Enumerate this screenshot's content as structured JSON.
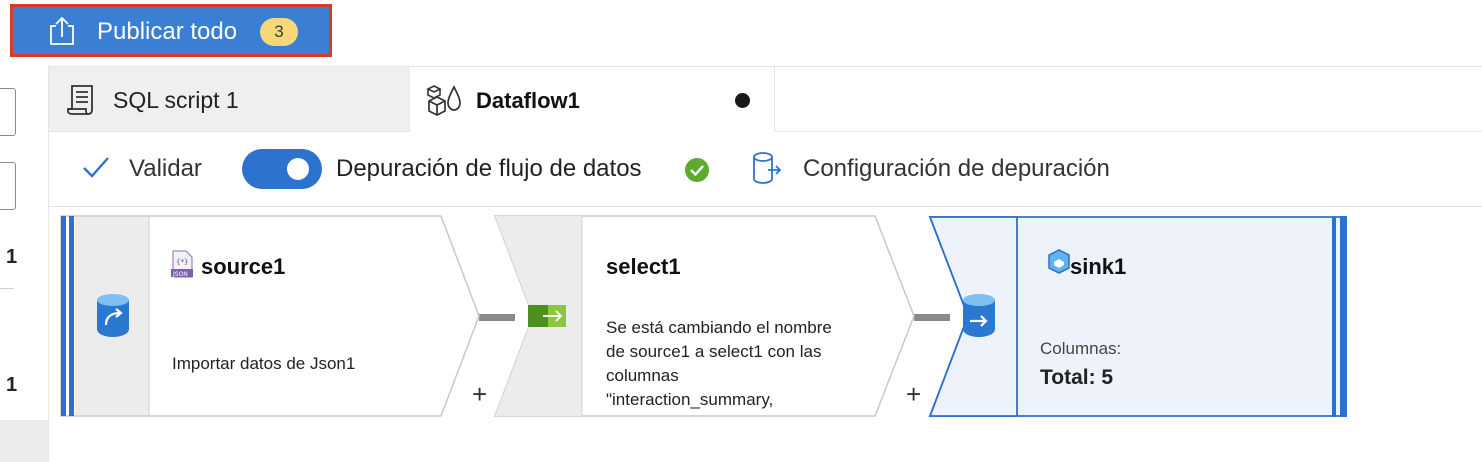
{
  "toolbar_top": {
    "publish_label": "Publicar todo",
    "publish_badge": "3"
  },
  "left_rail": {
    "numbers": [
      "1",
      "1"
    ]
  },
  "tabs": [
    {
      "label": "SQL script 1",
      "icon": "script-icon",
      "active": false
    },
    {
      "label": "Dataflow1",
      "icon": "dataflow-icon",
      "active": true,
      "unsaved": true
    }
  ],
  "dataflow_toolbar": {
    "validate_label": "Validar",
    "debug_label": "Depuración de flujo de datos",
    "debug_enabled": true,
    "debug_status": "ok",
    "config_label": "Configuración de depuración"
  },
  "nodes": {
    "source": {
      "title": "source1",
      "icon": "json-file-icon",
      "description": "Importar datos de Json1"
    },
    "select": {
      "title": "select1",
      "description_lines": [
        "Se está cambiando el nombre",
        "de source1 a select1 con las",
        "columnas",
        "\"interaction_summary,"
      ]
    },
    "sink": {
      "title": "sink1",
      "icon": "sink-icon",
      "columns_label": "Columnas:",
      "total_label": "Total: 5"
    },
    "add_symbol": "+"
  },
  "colors": {
    "accent": "#3b7fd4",
    "highlight_border": "#d83b25",
    "badge": "#f7d77a",
    "toggle": "#2d72cf",
    "success": "#5ea92f",
    "node_border_blue": "#2e6fd0"
  }
}
